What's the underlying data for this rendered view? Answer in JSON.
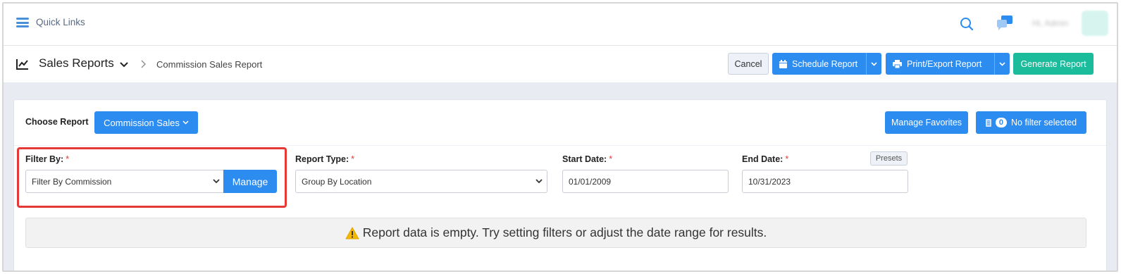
{
  "topbar": {
    "menu_icon": "hamburger-menu-icon",
    "quick_links_label": "Quick Links",
    "search_icon": "search-icon",
    "chat_icon": "chat-icon",
    "user_name": "Hi, Admin",
    "avatar": "avatar-icon"
  },
  "header": {
    "icon": "line-chart-icon",
    "title": "Sales Reports",
    "breadcrumb_current": "Commission Sales Report",
    "cancel_label": "Cancel",
    "schedule_label": "Schedule Report",
    "print_export_label": "Print/Export Report",
    "generate_label": "Generate Report"
  },
  "filters": {
    "choose_report_label": "Choose Report",
    "report_selected": "Commission Sales",
    "manage_favorites_label": "Manage Favorites",
    "filter_count": "0",
    "no_filter_label": "No filter selected",
    "filter_by": {
      "label": "Filter By:",
      "required_mark": "*",
      "value": "Filter By Commission",
      "manage_label": "Manage"
    },
    "report_type": {
      "label": "Report Type:",
      "required_mark": "*",
      "value": "Group By Location"
    },
    "start_date": {
      "label": "Start Date:",
      "required_mark": "*",
      "value": "01/01/2009"
    },
    "end_date": {
      "label": "End Date:",
      "required_mark": "*",
      "value": "10/31/2023"
    },
    "presets_label": "Presets"
  },
  "notice": {
    "icon": "warning-icon",
    "text": "Report data is empty. Try setting filters or adjust the date range for results."
  },
  "colors": {
    "primary": "#2d8cf0",
    "teal": "#1bbc9b",
    "highlight": "#e53935",
    "required": "#e03a3a",
    "warning": "#f5b800"
  }
}
